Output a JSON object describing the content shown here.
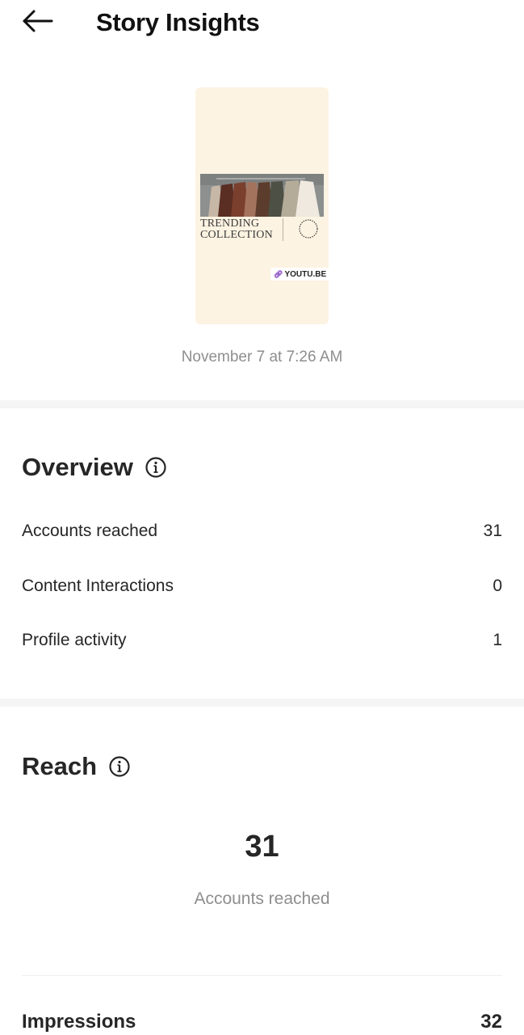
{
  "header": {
    "back_icon": "arrow-left-icon",
    "title": "Story Insights"
  },
  "story": {
    "thumbnail_bg": "#fdf3e2",
    "image_text_line1": "TRENDING",
    "image_text_line2": "COLLECTION",
    "link_icon": "link-icon",
    "link_label": "YOUTU.BE",
    "date": "November 7 at 7:26 AM"
  },
  "overview": {
    "title": "Overview",
    "info_icon": "info-icon",
    "rows": [
      {
        "label": "Accounts reached",
        "value": "31"
      },
      {
        "label": "Content Interactions",
        "value": "0"
      },
      {
        "label": "Profile activity",
        "value": "1"
      }
    ]
  },
  "reach": {
    "title": "Reach",
    "info_icon": "info-icon",
    "accounts_reached_value": "31",
    "accounts_reached_label": "Accounts reached",
    "impressions_label": "Impressions",
    "impressions_value": "32"
  },
  "colors": {
    "text_primary": "#262626",
    "text_secondary": "#8e8e8e",
    "separator": "#f5f5f5"
  }
}
